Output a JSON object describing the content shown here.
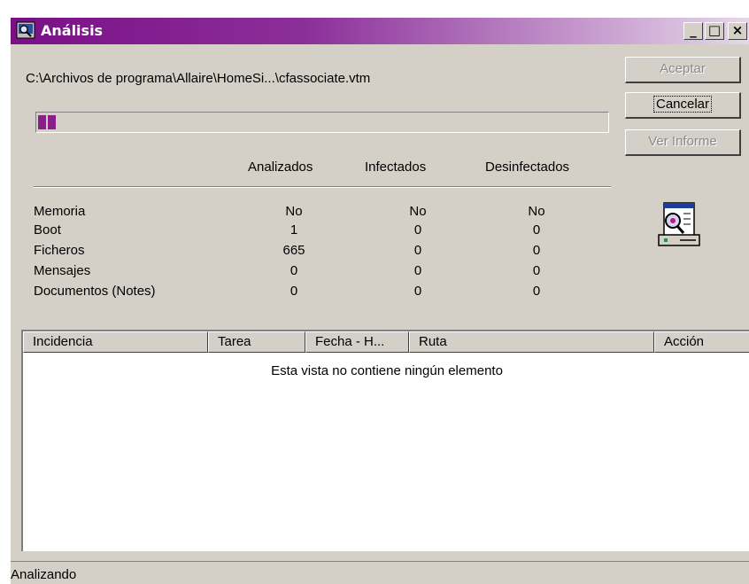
{
  "window": {
    "title": "Análisis",
    "controls": {
      "minimize": "_",
      "maximize": "□",
      "close": "×"
    }
  },
  "scan": {
    "current_path": "C:\\Archivos de programa\\Allaire\\HomeSi...\\cfassociate.vtm",
    "progress_blocks": 2
  },
  "buttons": {
    "accept": "Aceptar",
    "cancel": "Cancelar",
    "report": "Ver Informe"
  },
  "stats": {
    "columns": [
      "Analizados",
      "Infectados",
      "Desinfectados"
    ],
    "rows": [
      {
        "label": "Memoria",
        "values": [
          "No",
          "No",
          "No"
        ]
      },
      {
        "label": "Boot",
        "values": [
          "1",
          "0",
          "0"
        ]
      },
      {
        "label": "Ficheros",
        "values": [
          "665",
          "0",
          "0"
        ]
      },
      {
        "label": "Mensajes",
        "values": [
          "0",
          "0",
          "0"
        ]
      },
      {
        "label": "Documentos (Notes)",
        "values": [
          "0",
          "0",
          "0"
        ]
      }
    ]
  },
  "list": {
    "columns": [
      "Incidencia",
      "Tarea",
      "Fecha - H...",
      "Ruta",
      "Acción"
    ],
    "empty_message": "Esta vista no contiene ningún elemento"
  },
  "status": "Analizando",
  "colors": {
    "accent": "#8a1f8a",
    "face": "#d4d0c8"
  }
}
